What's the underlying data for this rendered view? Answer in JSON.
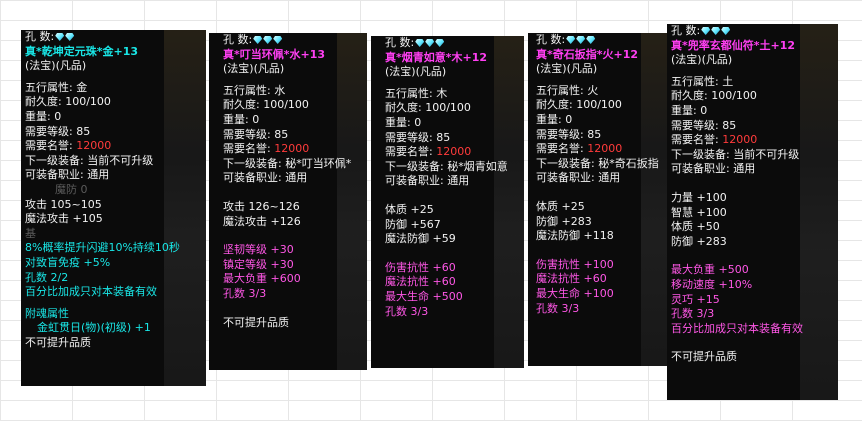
{
  "panels": [
    {
      "slots_label": "孔    数:",
      "gems": 2,
      "name": "真*乾坤定元珠*金+13",
      "type": "(法宝)(凡品)",
      "element": "五行属性: 金",
      "durability": "耐久度: 100/100",
      "weight": "重量: 0",
      "req_level": "需要等级: 85",
      "fame_label": "需要名誉: ",
      "fame_value": "12000",
      "next_equip": "下一级装备: 当前不可升级",
      "profession": "可装备职业: 通用",
      "faded_line": "魔防 0",
      "attack": "攻击 105~105",
      "magic_attack": "魔法攻击 +105",
      "faded_line2": "基",
      "effect1": "8%概率提升闪避10%持续10秒",
      "effect2": "对致盲免疫 +5%",
      "sockets": "孔数 2/2",
      "set_bonus": "百分比加成只对本装备有效",
      "soul_title": "附魂属性",
      "soul_value": "金虹贯日(物)(初级) +1",
      "cut_line": "不可提升品质"
    },
    {
      "slots_label": "孔    数:",
      "gems": 3,
      "name": "真*叮当环佩*水+13",
      "type": "(法宝)(凡品)",
      "element": "五行属性: 水",
      "durability": "耐久度: 100/100",
      "weight": "重量: 0",
      "req_level": "需要等级: 85",
      "fame_label": "需要名誉: ",
      "fame_value": "12000",
      "next_equip": "下一级装备: 秘*叮当环佩*",
      "profession": "可装备职业: 通用",
      "attack": "攻击 126~126",
      "magic_attack": "魔法攻击 +126",
      "hard_level": "坚韧等级 +30",
      "calm_level": "镇定等级 +30",
      "max_load": "最大负重 +600",
      "sockets": "孔数 3/3",
      "cannot_upgrade": "不可提升品质"
    },
    {
      "slots_label": "孔    数:",
      "gems": 3,
      "name": "真*烟青如意*木+12",
      "type": "(法宝)(凡品)",
      "element": "五行属性: 木",
      "durability": "耐久度: 100/100",
      "weight": "重量: 0",
      "req_level": "需要等级: 85",
      "fame_label": "需要名誉: ",
      "fame_value": "12000",
      "next_equip": "下一级装备: 秘*烟青如意",
      "profession": "可装备职业: 通用",
      "constitution": "体质 +25",
      "defense": "防御 +567",
      "magic_defense": "魔法防御 +59",
      "dmg_resist": "伤害抗性 +60",
      "magic_resist": "魔法抗性 +60",
      "max_hp": "最大生命 +500",
      "sockets": "孔数 3/3"
    },
    {
      "slots_label": "孔    数:",
      "gems": 3,
      "name": "真*奇石扳指*火+12",
      "type": "(法宝)(凡品)",
      "element": "五行属性: 火",
      "durability": "耐久度: 100/100",
      "weight": "重量: 0",
      "req_level": "需要等级: 85",
      "fame_label": "需要名誉: ",
      "fame_value": "12000",
      "next_equip": "下一级装备: 秘*奇石扳指",
      "profession": "可装备职业: 通用",
      "constitution": "体质 +25",
      "defense": "防御 +283",
      "magic_defense": "魔法防御 +118",
      "dmg_resist": "伤害抗性 +100",
      "magic_resist": "魔法抗性 +60",
      "max_hp": "最大生命 +100",
      "sockets": "孔数 3/3"
    },
    {
      "slots_label": "孔    数:",
      "gems": 3,
      "name": "真*兜率玄都仙符*土+12",
      "type": "(法宝)(凡品)",
      "element": "五行属性: 土",
      "durability": "耐久度: 100/100",
      "weight": "重量: 0",
      "req_level": "需要等级: 85",
      "fame_label": "需要名誉: ",
      "fame_value": "12000",
      "next_equip": "下一级装备: 当前不可升级",
      "profession": "可装备职业: 通用",
      "strength": "力量 +100",
      "wisdom": "智慧 +100",
      "constitution": "体质 +50",
      "defense": "防御 +283",
      "max_load": "最大负重 +500",
      "move_speed": "移动速度 +10%",
      "agility": "灵巧    +15",
      "sockets": "孔数 3/3",
      "set_bonus": "百分比加成只对本装备有效",
      "cannot_upgrade": "不可提升品质"
    }
  ]
}
